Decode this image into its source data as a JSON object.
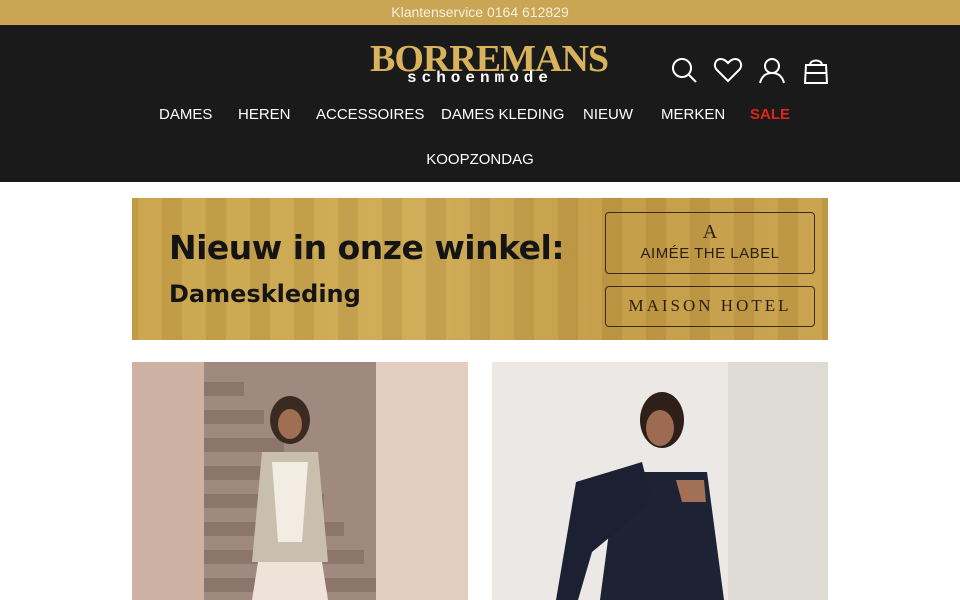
{
  "topbar": {
    "text": "Klantenservice 0164 612829"
  },
  "logo": {
    "main": "BORREMANS",
    "sub": "schoenmode"
  },
  "header_icons": [
    "search-icon",
    "heart-icon",
    "user-icon",
    "shopping-bag-icon"
  ],
  "nav": {
    "items": [
      {
        "label": "DAMES"
      },
      {
        "label": "HEREN"
      },
      {
        "label": "ACCESSOIRES"
      },
      {
        "label": "DAMES KLEDING"
      },
      {
        "label": "NIEUW"
      },
      {
        "label": "MERKEN"
      },
      {
        "label": "SALE"
      }
    ],
    "second_row": "KOOPZONDAG"
  },
  "banner": {
    "title": "Nieuw in onze winkel:",
    "subtitle": "Dameskleding",
    "brands": [
      {
        "monogram": "A",
        "label": "AIMÉE THE LABEL"
      },
      {
        "label": "MAISON HOTEL"
      }
    ]
  },
  "colors": {
    "topbar_bg": "#c9a554",
    "header_bg": "#1a1a1a",
    "logo_gold": "#d9b35c",
    "sale_red": "#e0241b"
  }
}
